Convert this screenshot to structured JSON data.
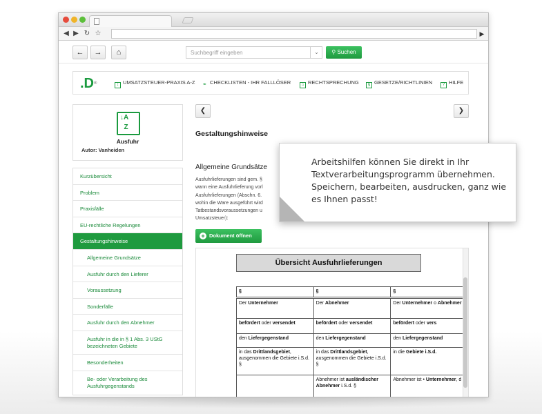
{
  "toolbar": {
    "back_icon": "arrow-left-icon",
    "forward_icon": "arrow-right-icon",
    "home_icon": "home-icon",
    "search_placeholder": "Suchbegriff eingeben",
    "search_button": "Suchen"
  },
  "menu": {
    "items": [
      {
        "label": "UMSATZSTEUER-PRAXIS A-Z",
        "icon": "az-icon"
      },
      {
        "label": "CHECKLISTEN - IHR FALLLÖSER",
        "icon": "wrench-icon"
      },
      {
        "label": "RECHTSPRECHUNG",
        "icon": "court-icon"
      },
      {
        "label": "GESETZE/RICHTLINIEN",
        "icon": "paragraph-icon"
      },
      {
        "label": "HILFE",
        "icon": "help-icon"
      }
    ]
  },
  "document": {
    "title": "Ausfuhr",
    "author": "Autor: Vanheiden"
  },
  "sidebar": {
    "items": [
      "Kurzübersicht",
      "Problem",
      "Praxisfälle",
      "EU-rechtliche Regelungen",
      "Gestaltungshinweise",
      "Allgemeine Grundsätze",
      "Ausfuhr durch den Lieferer",
      "Voraussetzung",
      "Sonderfälle",
      "Ausfuhr durch den Abnehmer",
      "Ausfuhr in die in § 1 Abs. 3 UStG bezeichneten Gebiete",
      "Besonderheiten",
      "Be- oder Verarbeitung des Ausfuhrgegenstands"
    ]
  },
  "main": {
    "title": "Gestaltungshinweise",
    "section_heading": "Allgemeine Grundsätze",
    "body_lines": [
      "Ausfuhrlieferungen sind gem. §",
      "wann eine Ausfuhrlieferung vorl",
      "Ausfuhrlieferungen (Abschn. 6.",
      "wohin die Ware ausgeführt wird",
      "Tatbestandsvoraussetzungen u",
      "Umsatzsteuer):"
    ],
    "open_button": "Dokument öffnen"
  },
  "preview": {
    "title": "Übersicht Ausfuhrlieferungen",
    "rows": [
      [
        "§",
        "§",
        "§"
      ],
      [
        "Der **Unternehmer**",
        "Der **Abnehmer**",
        "Der **Unternehmer** o **Abnehmer**"
      ],
      [
        "**befördert** oder **versendet**",
        "**befördert** oder **versendet**",
        "**befördert** oder **vers**"
      ],
      [
        "den **Liefergegenstand**",
        "den **Liefergegenstand**",
        "den **Liefergegenstand**"
      ],
      [
        "in das **Drittlandsgebiet**, ausgenommen die Gebiete i.S.d. §",
        "in das **Drittlandsgebiet**, ausgenommen die Gebiete i.S.d. §",
        "in die **Gebiete i.S.d.**"
      ],
      [
        "",
        "Abnehmer ist **ausländischer Abnehmer** i.S.d. §",
        "Abnehmer ist • **Unternehmer**, d"
      ]
    ]
  },
  "callout": {
    "text": "Arbeitshilfen können Sie direkt in Ihr Textverarbeitungsprogramm übernehmen. Speichern, bearbeiten, ausdrucken, ganz wie es Ihnen passt!"
  },
  "colors": {
    "accent": "#1f9a3f",
    "text": "#222222"
  }
}
